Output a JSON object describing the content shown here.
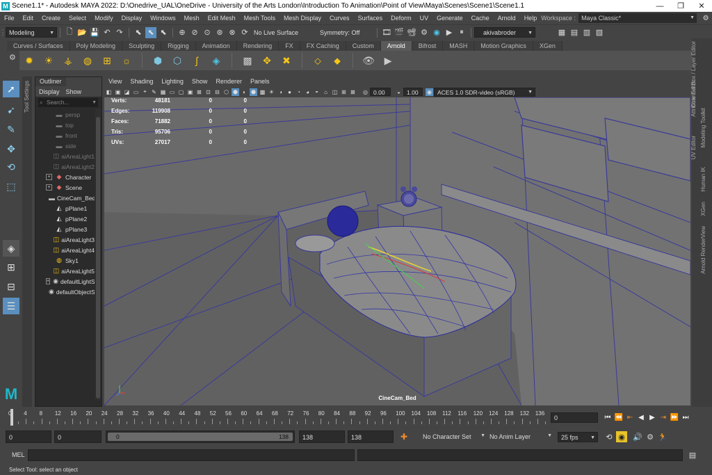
{
  "window": {
    "title": "Scene1.1* - Autodesk MAYA 2022: D:\\Onedrive_UAL\\OneDrive - University of the Arts London\\Introduction To Animation\\Point of View\\Maya\\Scenes\\Scene1\\Scene1.1",
    "minimize": "—",
    "maximize": "❐",
    "close": "✕"
  },
  "menubar": {
    "items": [
      "File",
      "Edit",
      "Create",
      "Select",
      "Modify",
      "Display",
      "Windows",
      "Mesh",
      "Edit Mesh",
      "Mesh Tools",
      "Mesh Display",
      "Curves",
      "Surfaces",
      "Deform",
      "UV",
      "Generate",
      "Cache",
      "Arnold",
      "Help"
    ],
    "workspace_label": "Workspace :",
    "workspace_value": "Maya Classic*"
  },
  "statusline": {
    "menuset": "Modeling",
    "live_surface": "No Live Surface",
    "symmetry": "Symmetry: Off",
    "user": "akivabroder"
  },
  "shelf": {
    "tabs": [
      "Curves / Surfaces",
      "Poly Modeling",
      "Sculpting",
      "Rigging",
      "Animation",
      "Rendering",
      "FX",
      "FX Caching",
      "Custom",
      "Arnold",
      "Bifrost",
      "MASH",
      "Motion Graphics",
      "XGen"
    ],
    "active_tab": "Arnold"
  },
  "toolsettings_label": "Tool Settings",
  "outliner": {
    "tab": "Outliner",
    "menu": [
      "Display",
      "Show"
    ],
    "search_placeholder": "Search...",
    "items": [
      {
        "label": "persp",
        "icon": "camera-icon",
        "expand": false,
        "dim": true
      },
      {
        "label": "top",
        "icon": "camera-icon",
        "expand": false,
        "dim": true
      },
      {
        "label": "front",
        "icon": "camera-icon",
        "expand": false,
        "dim": true
      },
      {
        "label": "side",
        "icon": "camera-icon",
        "expand": false,
        "dim": true
      },
      {
        "label": "aiAreaLight1",
        "icon": "area-light-icon",
        "expand": false,
        "dim": true
      },
      {
        "label": "aiAreaLight2",
        "icon": "area-light-icon",
        "expand": false,
        "dim": true
      },
      {
        "label": "Character",
        "icon": "group-icon",
        "expand": true,
        "dim": false
      },
      {
        "label": "Scene",
        "icon": "group-icon",
        "expand": true,
        "dim": false
      },
      {
        "label": "CineCam_Bed",
        "icon": "camera-icon",
        "expand": false,
        "dim": false
      },
      {
        "label": "pPlane1",
        "icon": "mesh-icon",
        "expand": false,
        "dim": false
      },
      {
        "label": "pPlane2",
        "icon": "mesh-icon",
        "expand": false,
        "dim": false
      },
      {
        "label": "pPlane3",
        "icon": "mesh-icon",
        "expand": false,
        "dim": false
      },
      {
        "label": "aiAreaLight3",
        "icon": "area-light-icon",
        "expand": false,
        "dim": false
      },
      {
        "label": "aiAreaLight4",
        "icon": "area-light-icon",
        "expand": false,
        "dim": false
      },
      {
        "label": "Sky1",
        "icon": "sky-icon",
        "expand": false,
        "dim": false
      },
      {
        "label": "aiAreaLight5",
        "icon": "area-light-icon",
        "expand": false,
        "dim": false
      },
      {
        "label": "defaultLightSet",
        "icon": "set-icon",
        "expand": true,
        "dim": false
      },
      {
        "label": "defaultObjectSet",
        "icon": "set-icon",
        "expand": false,
        "dim": false
      }
    ]
  },
  "viewport": {
    "menu": [
      "View",
      "Shading",
      "Lighting",
      "Show",
      "Renderer",
      "Panels"
    ],
    "exposure": "0.00",
    "gamma": "1.00",
    "color_space": "ACES 1.0 SDR-video (sRGB)",
    "hud": [
      {
        "label": "Verts:",
        "v1": "48181",
        "v2": "0",
        "v3": "0"
      },
      {
        "label": "Edges:",
        "v1": "119908",
        "v2": "0",
        "v3": "0"
      },
      {
        "label": "Faces:",
        "v1": "71882",
        "v2": "0",
        "v3": "0"
      },
      {
        "label": "Tris:",
        "v1": "95706",
        "v2": "0",
        "v3": "0"
      },
      {
        "label": "UVs:",
        "v1": "27017",
        "v2": "0",
        "v3": "0"
      }
    ],
    "camera_name": "CineCam_Bed",
    "axis_labels": {
      "x": "x",
      "y": "y",
      "z": "z"
    }
  },
  "right_tabs": [
    "Channel Box / Layer Editor",
    "Attribute Editor",
    "Modeling Toolkit",
    "UV Editor",
    "Human IK",
    "XGen",
    "Arnold RenderView"
  ],
  "timeslider": {
    "ticks": [
      "0",
      "4",
      "8",
      "12",
      "16",
      "20",
      "24",
      "28",
      "32",
      "36",
      "40",
      "44",
      "48",
      "52",
      "56",
      "60",
      "64",
      "68",
      "72",
      "76",
      "80",
      "84",
      "88",
      "92",
      "96",
      "100",
      "104",
      "108",
      "112",
      "116",
      "120",
      "124",
      "128",
      "132",
      "136"
    ],
    "current_frame": "0"
  },
  "range": {
    "start": "0",
    "anim_start": "0",
    "slider_start": "0",
    "slider_end": "138",
    "anim_end": "138",
    "end": "138",
    "character_set": "No Character Set",
    "anim_layer": "No Anim Layer",
    "fps": "25 fps"
  },
  "commandline": {
    "label": "MEL"
  },
  "helpline": {
    "text": "Select Tool: select an object"
  }
}
